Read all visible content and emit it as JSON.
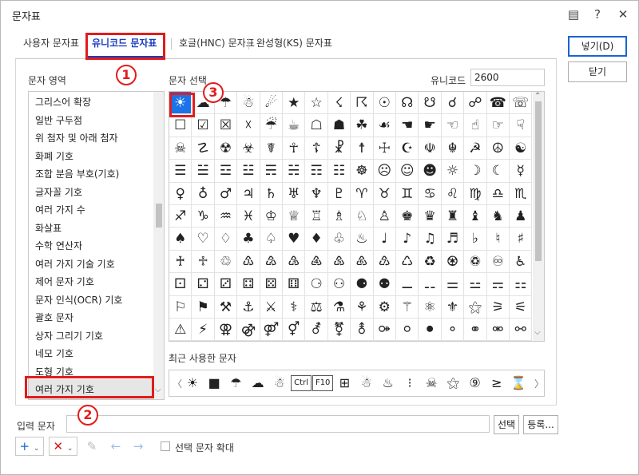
{
  "window": {
    "title": "문자표",
    "help_label": "?",
    "close_label": "✕"
  },
  "tabs": [
    {
      "label": "사용자 문자표"
    },
    {
      "label": "유니코드 문자표"
    },
    {
      "label": "호글(HNC) 문자표"
    },
    {
      "label": "완성형(KS) 문자표"
    }
  ],
  "buttons": {
    "insert": "넣기(D)",
    "close": "닫기",
    "select": "선택",
    "register": "등록..."
  },
  "area": {
    "label": "문자 영역",
    "items": [
      "그리스어 확장",
      "일반 구두점",
      "위 첨자 및 아래 첨자",
      "화폐 기호",
      "조합 분음 부호(기호)",
      "글자꼴 기호",
      "여러 가지 수",
      "화살표",
      "수학 연산자",
      "여러 가지 기술 기호",
      "제어 문자 기호",
      "문자 인식(OCR) 기호",
      "괄호 문자",
      "상자 그리기 기호",
      "네모 기호",
      "도형 기호",
      "여러 가지 기호"
    ]
  },
  "charsel": {
    "label": "문자 선택",
    "unicode_label": "유니코드",
    "unicode_value": "2600"
  },
  "grid": [
    [
      "☀",
      "☁",
      "☂",
      "☃",
      "☄",
      "★",
      "☆",
      "☇",
      "☈",
      "☉",
      "☊",
      "☋",
      "☌",
      "☍",
      "☎",
      "☏"
    ],
    [
      "☐",
      "☑",
      "☒",
      "☓",
      "☔",
      "☕",
      "☖",
      "☗",
      "☘",
      "☙",
      "☚",
      "☛",
      "☜",
      "☝",
      "☞",
      "☟"
    ],
    [
      "☠",
      "☡",
      "☢",
      "☣",
      "☤",
      "☥",
      "☦",
      "☧",
      "☨",
      "☩",
      "☪",
      "☫",
      "☬",
      "☭",
      "☮",
      "☯"
    ],
    [
      "☰",
      "☱",
      "☲",
      "☳",
      "☴",
      "☵",
      "☶",
      "☷",
      "☸",
      "☹",
      "☺",
      "☻",
      "☼",
      "☽",
      "☾",
      "☿"
    ],
    [
      "♀",
      "♁",
      "♂",
      "♃",
      "♄",
      "♅",
      "♆",
      "♇",
      "♈",
      "♉",
      "♊",
      "♋",
      "♌",
      "♍",
      "♎",
      "♏"
    ],
    [
      "♐",
      "♑",
      "♒",
      "♓",
      "♔",
      "♕",
      "♖",
      "♗",
      "♘",
      "♙",
      "♚",
      "♛",
      "♜",
      "♝",
      "♞",
      "♟"
    ],
    [
      "♠",
      "♡",
      "♢",
      "♣",
      "♤",
      "♥",
      "♦",
      "♧",
      "♨",
      "♩",
      "♪",
      "♫",
      "♬",
      "♭",
      "♮",
      "♯"
    ],
    [
      "♰",
      "♱",
      "♲",
      "♳",
      "♴",
      "♵",
      "♶",
      "♷",
      "♸",
      "♹",
      "♺",
      "♻",
      "♼",
      "♽",
      "♾",
      "♿"
    ],
    [
      "⚀",
      "⚁",
      "⚂",
      "⚃",
      "⚄",
      "⚅",
      "⚆",
      "⚇",
      "⚈",
      "⚉",
      "⚊",
      "⚋",
      "⚌",
      "⚍",
      "⚎",
      "⚏"
    ],
    [
      "⚐",
      "⚑",
      "⚒",
      "⚓",
      "⚔",
      "⚕",
      "⚖",
      "⚗",
      "⚘",
      "⚙",
      "⚚",
      "⚛",
      "⚜",
      "⚝",
      "⚞",
      "⚟"
    ],
    [
      "⚠",
      "⚡",
      "⚢",
      "⚣",
      "⚤",
      "⚥",
      "⚦",
      "⚧",
      "⚨",
      "⚩",
      "⚪",
      "⚫",
      "⚬",
      "⚭",
      "⚮",
      "⚯"
    ]
  ],
  "recent": {
    "label": "최근 사용한 문자",
    "items": [
      "☀",
      "■",
      "☂",
      "☁",
      "☃",
      "Ctrl",
      "F10",
      "⊞",
      "☃",
      "♨",
      "⁝",
      "☠",
      "⚝",
      "⑨",
      "≥",
      "⌛"
    ]
  },
  "input": {
    "label": "입력 문자",
    "value": ""
  },
  "tools": {
    "add": "+",
    "delete": "✕",
    "edit": "✎",
    "left": "←",
    "right": "→"
  },
  "enlarge_label": "선택 문자 확대",
  "callouts": [
    "1",
    "2",
    "3"
  ]
}
